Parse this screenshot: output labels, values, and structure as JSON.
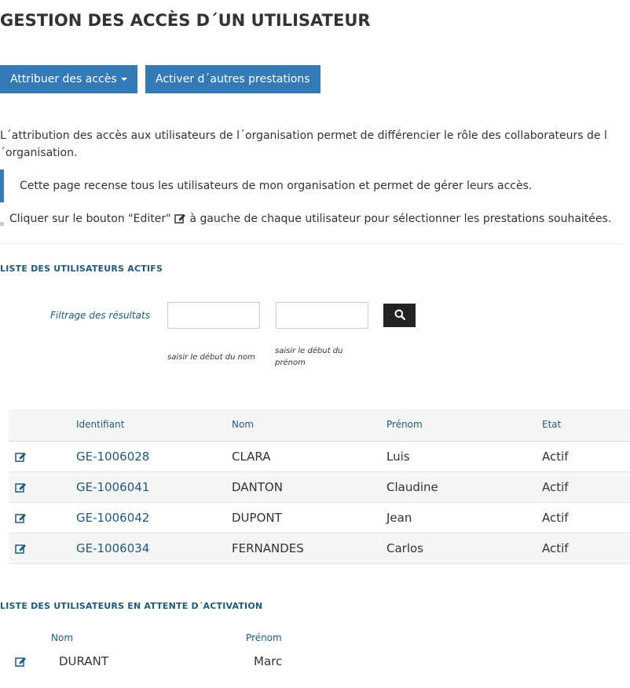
{
  "page": {
    "title": "GESTION DES ACCÈS D´UN UTILISATEUR"
  },
  "toolbar": {
    "assign_label": "Attribuer des accès",
    "activate_label": "Activer d´autres prestations"
  },
  "intro": {
    "paragraph": "L´attribution des accès aux utilisateurs de l´organisation permet de différencier le rôle des collaborateurs de l´organisation.",
    "quote": "Cette page recense tous les utilisateurs de mon organisation et permet de gérer leurs accès.",
    "instruction_before": "Cliquer sur le bouton \"Editer\"",
    "instruction_after": "à gauche de chaque utilisateur pour sélectionner les prestations souhaitées."
  },
  "active_users": {
    "section_title": "LISTE DES UTILISATEURS ACTIFS",
    "filter": {
      "label": "Filtrage des résultats",
      "name_hint": "saisir le début du nom",
      "firstname_hint": "saisir le début du prénom",
      "name_value": "",
      "firstname_value": ""
    },
    "columns": [
      "Identifiant",
      "Nom",
      "Prénom",
      "Etat"
    ],
    "rows": [
      {
        "id": "GE-1006028",
        "nom": "CLARA",
        "prenom": "Luis",
        "etat": "Actif"
      },
      {
        "id": "GE-1006041",
        "nom": "DANTON",
        "prenom": "Claudine",
        "etat": "Actif"
      },
      {
        "id": "GE-1006042",
        "nom": "DUPONT",
        "prenom": "Jean",
        "etat": "Actif"
      },
      {
        "id": "GE-1006034",
        "nom": "FERNANDES",
        "prenom": "Carlos",
        "etat": "Actif"
      }
    ]
  },
  "pending_users": {
    "section_title": "LISTE DES UTILISATEURS EN ATTENTE D´ACTIVATION",
    "columns": [
      "Nom",
      "Prénom"
    ],
    "rows": [
      {
        "nom": "DURANT",
        "prenom": "Marc"
      }
    ]
  },
  "icons": {
    "edit": "edit-icon",
    "search": "search-icon",
    "caret": "caret-down-icon"
  },
  "colors": {
    "primary": "#337ab7",
    "heading_blue": "#1f5a7a",
    "text": "#333333"
  }
}
